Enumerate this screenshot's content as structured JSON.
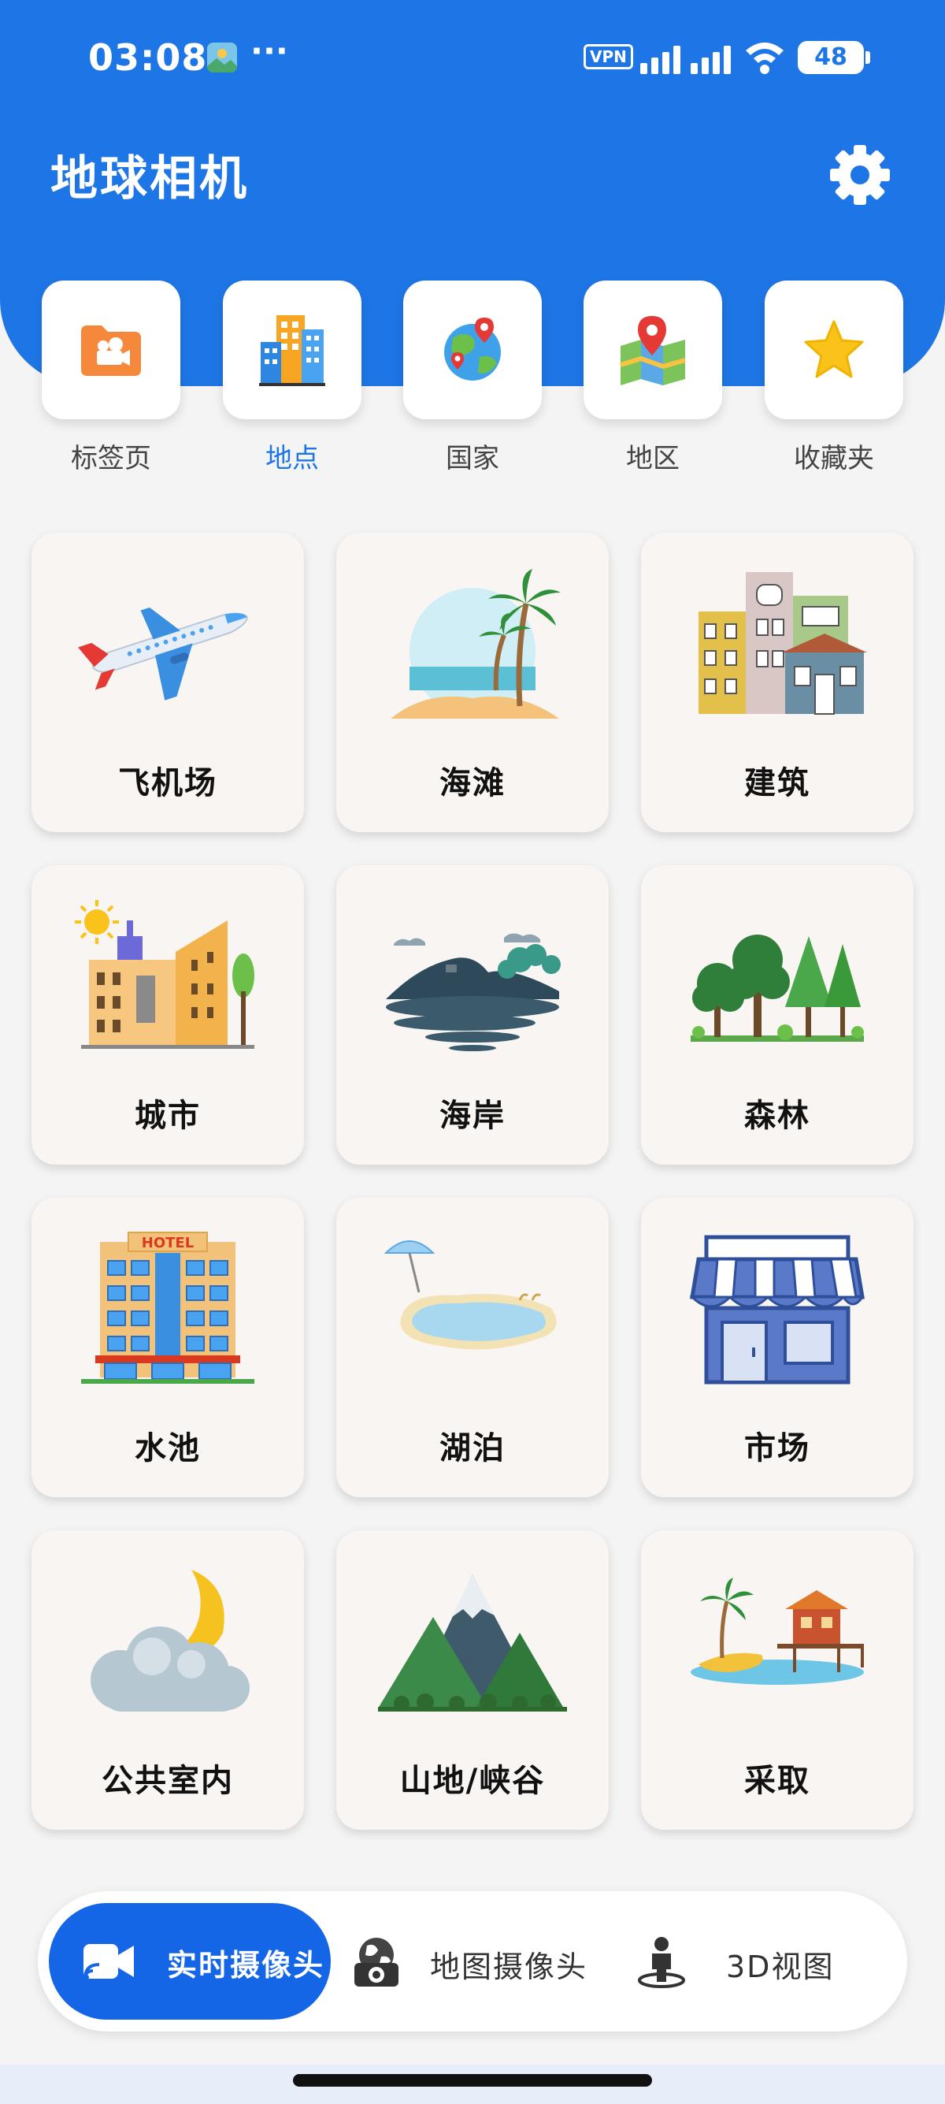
{
  "status_bar": {
    "time": "03:08",
    "more": "···",
    "vpn": "VPN",
    "battery": "48"
  },
  "header": {
    "title": "地球相机"
  },
  "tabs": [
    {
      "label": "标签页",
      "icon": "folder-camera-icon"
    },
    {
      "label": "地点",
      "icon": "buildings-icon",
      "active": true
    },
    {
      "label": "国家",
      "icon": "globe-pins-icon"
    },
    {
      "label": "地区",
      "icon": "map-pin-icon"
    },
    {
      "label": "收藏夹",
      "icon": "star-icon"
    }
  ],
  "grid": [
    {
      "label": "飞机场",
      "icon": "airplane-icon"
    },
    {
      "label": "海滩",
      "icon": "beach-palm-icon"
    },
    {
      "label": "建筑",
      "icon": "buildings-illustration-icon"
    },
    {
      "label": "城市",
      "icon": "city-icon"
    },
    {
      "label": "海岸",
      "icon": "coast-icon"
    },
    {
      "label": "森林",
      "icon": "forest-icon"
    },
    {
      "label": "水池",
      "icon": "hotel-icon"
    },
    {
      "label": "湖泊",
      "icon": "pool-icon"
    },
    {
      "label": "市场",
      "icon": "market-icon"
    },
    {
      "label": "公共室内",
      "icon": "moon-cloud-icon"
    },
    {
      "label": "山地/峡谷",
      "icon": "mountain-icon"
    },
    {
      "label": "采取",
      "icon": "island-hut-icon"
    }
  ],
  "hotel_sign": "HOTEL",
  "bottom_nav": [
    {
      "label": "实时摄像头",
      "icon": "video-camera-icon",
      "active": true
    },
    {
      "label": "地图摄像头",
      "icon": "globe-camera-icon"
    },
    {
      "label": "3D视图",
      "icon": "person-pin-icon"
    }
  ],
  "colors": {
    "primary": "#1e76e6",
    "active_nav": "#1466e6",
    "card_bg": "#f8f5f3",
    "page_bg": "#f4f4f4"
  }
}
